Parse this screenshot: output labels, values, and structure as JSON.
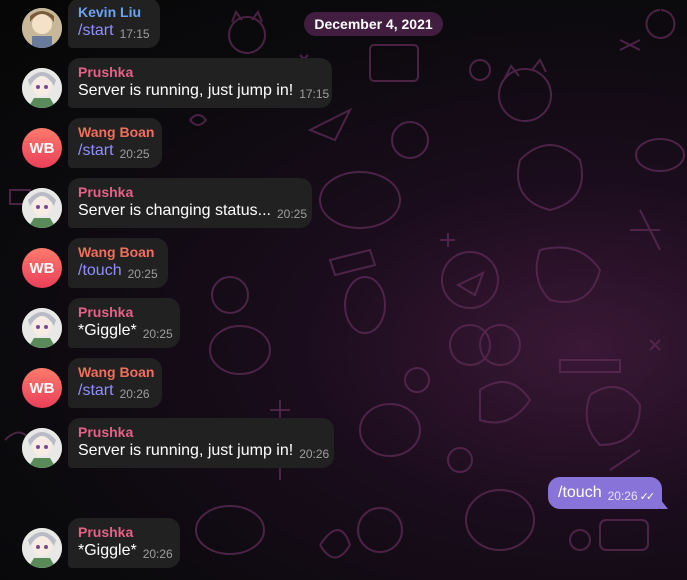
{
  "date_label": "December 4, 2021",
  "messages": [
    {
      "sender": "Kevin Liu",
      "text": "/start",
      "time": "17:15"
    },
    {
      "sender": "Prushka",
      "text": "Server is running, just jump in!",
      "time": "17:15"
    },
    {
      "sender": "Wang Boan",
      "avatar": "WB",
      "text": "/start",
      "time": "20:25"
    },
    {
      "sender": "Prushka",
      "text": "Server is changing status...",
      "time": "20:25"
    },
    {
      "sender": "Wang Boan",
      "avatar": "WB",
      "text": "/touch",
      "time": "20:25"
    },
    {
      "sender": "Prushka",
      "text": "*Giggle*",
      "time": "20:25"
    },
    {
      "sender": "Wang Boan",
      "avatar": "WB",
      "text": "/start",
      "time": "20:26"
    },
    {
      "sender": "Prushka",
      "text": "Server is running, just jump in!",
      "time": "20:26"
    },
    {
      "sender": "Prushka",
      "text": "*Giggle*",
      "time": "20:26"
    }
  ],
  "outgoing": {
    "text": "/touch",
    "time": "20:26",
    "status": "read",
    "check_glyph": "✓✓"
  },
  "colors": {
    "bubble_in": "#212121",
    "bubble_out": "#8873d8",
    "prushka_name": "#e36287",
    "wang_name": "#f06e5e",
    "kevin_name": "#6ba4f5",
    "command_text": "#8f8fff"
  }
}
